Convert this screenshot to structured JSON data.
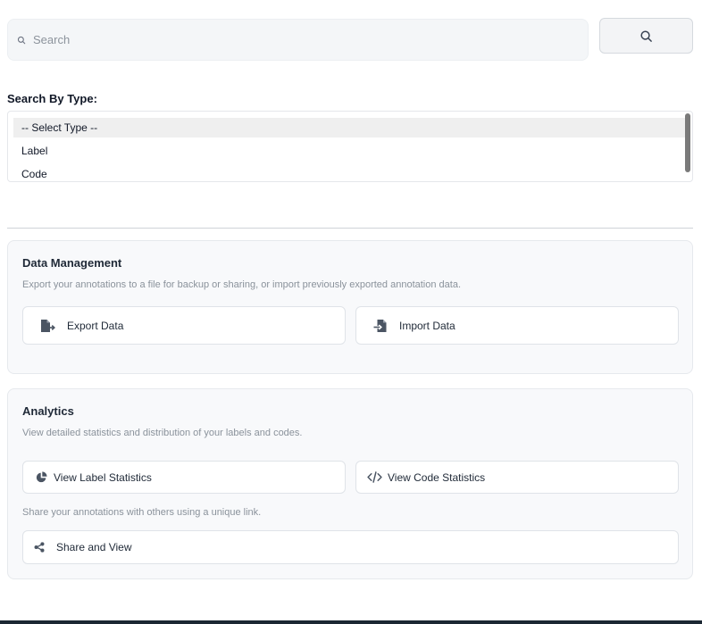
{
  "search": {
    "placeholder": "Search",
    "button_icon": "search-icon"
  },
  "type_filter": {
    "heading": "Search By Type:",
    "options": [
      "-- Select Type --",
      "Label",
      "Code"
    ],
    "selected": "-- Select Type --"
  },
  "data_management": {
    "title": "Data Management",
    "description": "Export your annotations to a file for backup or sharing, or import previously exported annotation data.",
    "export_label": "Export Data",
    "import_label": "Import Data"
  },
  "analytics": {
    "title": "Analytics",
    "description": "View detailed statistics and distribution of your labels and codes.",
    "label_stats_label": "View Label Statistics",
    "code_stats_label": "View Code Statistics",
    "share_description": "Share your annotations with others using a unique link.",
    "share_label": "Share and View"
  },
  "colors": {
    "icon": "#4b5563",
    "card_bg": "#f8f9fb"
  }
}
